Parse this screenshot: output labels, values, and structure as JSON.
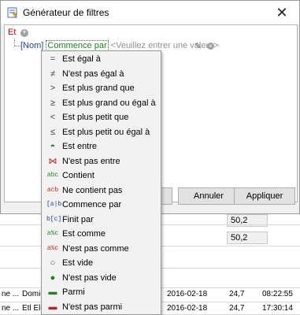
{
  "window": {
    "title": "Générateur de filtres",
    "close": "✕"
  },
  "editor": {
    "group_op": "Et",
    "field": "[Nom]",
    "operator": "Commence par",
    "value_placeholder": "<Veuillez entrer une valeur>"
  },
  "buttons": {
    "cancel": "Annuler",
    "apply": "Appliquer"
  },
  "menu": {
    "items": [
      {
        "label": "Est égal à",
        "icon": "="
      },
      {
        "label": "N'est pas égal à",
        "icon": "≠"
      },
      {
        "label": "Est plus grand que",
        "icon": ">"
      },
      {
        "label": "Est plus grand ou égal à",
        "icon": "≥"
      },
      {
        "label": "Est plus petit que",
        "icon": "<"
      },
      {
        "label": "Est plus petit ou égal à",
        "icon": "≤"
      },
      {
        "label": "Est entre",
        "icon": "◓"
      },
      {
        "label": "N'est pas entre",
        "icon": "⋈"
      },
      {
        "label": "Contient",
        "icon": "abc"
      },
      {
        "label": "Ne contient pas",
        "icon": "acb"
      },
      {
        "label": "Commence par",
        "icon": "[a|b"
      },
      {
        "label": "Finit par",
        "icon": "b[c]"
      },
      {
        "label": "Est comme",
        "icon": "a%c"
      },
      {
        "label": "N'est pas comme",
        "icon": "a%c"
      },
      {
        "label": "Est vide",
        "icon": "○"
      },
      {
        "label": "N'est pas vide",
        "icon": "●"
      },
      {
        "label": "Parmi",
        "icon": "▬"
      },
      {
        "label": "N'est pas parmi",
        "icon": "▬"
      }
    ]
  },
  "background": {
    "cell1": "50,2",
    "cell2": "50,2",
    "rows": [
      {
        "c1": "ne ...",
        "c2": "Domic",
        "date": "2016-02-18",
        "num": "24,7",
        "time": "08:22:55"
      },
      {
        "c1": "ne ...",
        "c2": "Etl Ele",
        "date": "2016-02-18",
        "num": "24,7",
        "time": "17:30:14"
      }
    ]
  }
}
